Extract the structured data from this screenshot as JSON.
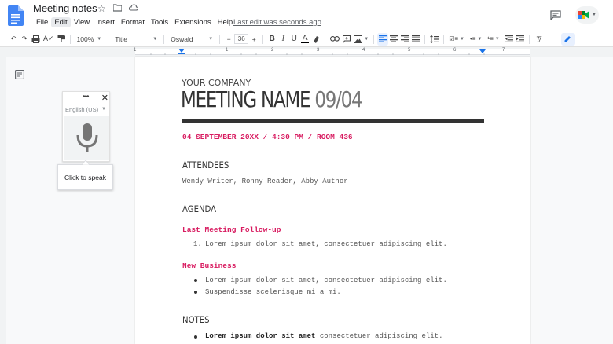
{
  "app": {
    "doc_title": "Meeting notes",
    "menu": [
      "File",
      "Edit",
      "View",
      "Insert",
      "Format",
      "Tools",
      "Extensions",
      "Help"
    ],
    "active_menu": "Edit",
    "last_edit": "Last edit was seconds ago"
  },
  "toolbar": {
    "zoom": "100%",
    "style": "Title",
    "font": "Oswald",
    "font_size": "36",
    "minus": "−",
    "plus": "+"
  },
  "ruler": {
    "ticks": [
      "1",
      "1",
      "2",
      "3",
      "4",
      "5",
      "6",
      "7"
    ]
  },
  "voice_typing": {
    "menu_dots": "•••",
    "close": "✕",
    "language": "English (US)",
    "tooltip": "Click to speak"
  },
  "document": {
    "company": "YOUR COMPANY",
    "title_main": "MEETING NAME",
    "title_date": "09/04",
    "dateline": "04 SEPTEMBER 20XX / 4:30 PM / ROOM 436",
    "attendees_heading": "ATTENDEES",
    "attendees": "Wendy Writer, Ronny Reader, Abby Author",
    "agenda_heading": "AGENDA",
    "followup_heading": "Last Meeting Follow-up",
    "followup_items": [
      "Lorem ipsum dolor sit amet, consectetuer adipiscing elit."
    ],
    "new_business_heading": "New Business",
    "new_business_items": [
      "Lorem ipsum dolor sit amet, consectetuer adipiscing elit.",
      "Suspendisse scelerisque mi a mi."
    ],
    "notes_heading": "NOTES",
    "notes_bold": "Lorem ipsum dolor sit amet",
    "notes_rest": " consectetuer adipiscing elit."
  },
  "colors": {
    "accent_pink": "#d81b60",
    "docs_blue": "#4285f4",
    "toolbar_active": "#e8f0fe"
  }
}
